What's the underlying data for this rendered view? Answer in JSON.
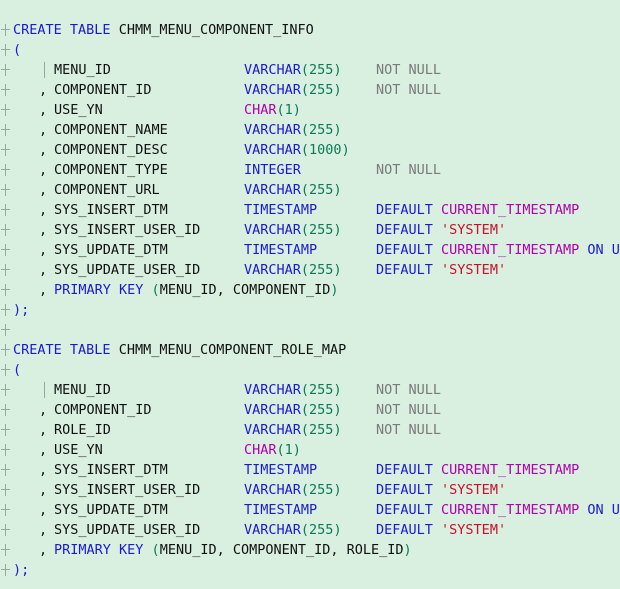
{
  "tables": [
    {
      "name": "CHMM_MENU_COMPONENT_INFO",
      "columns": [
        {
          "prefix": "",
          "name": "MENU_ID",
          "type": "VARCHAR",
          "size": "255",
          "constraint": "NOT NULL"
        },
        {
          "prefix": ",",
          "name": "COMPONENT_ID",
          "type": "VARCHAR",
          "size": "255",
          "constraint": "NOT NULL"
        },
        {
          "prefix": ",",
          "name": "USE_YN",
          "type": "CHAR",
          "size": "1",
          "constraint": ""
        },
        {
          "prefix": ",",
          "name": "COMPONENT_NAME",
          "type": "VARCHAR",
          "size": "255",
          "constraint": ""
        },
        {
          "prefix": ",",
          "name": "COMPONENT_DESC",
          "type": "VARCHAR",
          "size": "1000",
          "constraint": ""
        },
        {
          "prefix": ",",
          "name": "COMPONENT_TYPE",
          "type": "INTEGER",
          "size": "",
          "constraint": "NOT NULL"
        },
        {
          "prefix": ",",
          "name": "COMPONENT_URL",
          "type": "VARCHAR",
          "size": "255",
          "constraint": ""
        },
        {
          "prefix": ",",
          "name": "SYS_INSERT_DTM",
          "type": "TIMESTAMP",
          "size": "",
          "default": "CURRENT_TIMESTAMP"
        },
        {
          "prefix": ",",
          "name": "SYS_INSERT_USER_ID",
          "type": "VARCHAR",
          "size": "255",
          "default_str": "'SYSTEM'"
        },
        {
          "prefix": ",",
          "name": "SYS_UPDATE_DTM",
          "type": "TIMESTAMP",
          "size": "",
          "default": "CURRENT_TIMESTAMP",
          "suffix": " ON U"
        },
        {
          "prefix": ",",
          "name": "SYS_UPDATE_USER_ID",
          "type": "VARCHAR",
          "size": "255",
          "default_str": "'SYSTEM'"
        }
      ],
      "primary_key": "MENU_ID, COMPONENT_ID"
    },
    {
      "name": "CHMM_MENU_COMPONENT_ROLE_MAP",
      "columns": [
        {
          "prefix": "",
          "name": "MENU_ID",
          "type": "VARCHAR",
          "size": "255",
          "constraint": "NOT NULL"
        },
        {
          "prefix": ",",
          "name": "COMPONENT_ID",
          "type": "VARCHAR",
          "size": "255",
          "constraint": "NOT NULL"
        },
        {
          "prefix": ",",
          "name": "ROLE_ID",
          "type": "VARCHAR",
          "size": "255",
          "constraint": "NOT NULL"
        },
        {
          "prefix": ",",
          "name": "USE_YN",
          "type": "CHAR",
          "size": "1",
          "constraint": ""
        },
        {
          "prefix": ",",
          "name": "SYS_INSERT_DTM",
          "type": "TIMESTAMP",
          "size": "",
          "default": "CURRENT_TIMESTAMP"
        },
        {
          "prefix": ",",
          "name": "SYS_INSERT_USER_ID",
          "type": "VARCHAR",
          "size": "255",
          "default_str": "'SYSTEM'"
        },
        {
          "prefix": ",",
          "name": "SYS_UPDATE_DTM",
          "type": "TIMESTAMP",
          "size": "",
          "default": "CURRENT_TIMESTAMP",
          "suffix": " ON U"
        },
        {
          "prefix": ",",
          "name": "SYS_UPDATE_USER_ID",
          "type": "VARCHAR",
          "size": "255",
          "default_str": "'SYSTEM'"
        }
      ],
      "primary_key": "MENU_ID, COMPONENT_ID, ROLE_ID"
    }
  ],
  "keywords": {
    "create_table": "CREATE TABLE",
    "primary_key": "PRIMARY KEY",
    "default": "DEFAULT",
    "open_paren": "(",
    "close_stmt": ");"
  },
  "colors": {
    "background": "#d9efdf",
    "keyword": "#1a1ad6",
    "number": "#0a7a5a",
    "function": "#b000b0",
    "string": "#c8102e",
    "constraint": "#7a7a7a"
  }
}
